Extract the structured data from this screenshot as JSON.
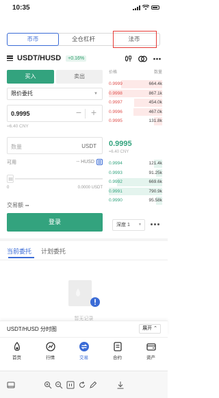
{
  "status": {
    "time": "10:35"
  },
  "tabs": [
    "币币",
    "全仓杠杆",
    "法币"
  ],
  "pair": {
    "name": "USDT/HUSD",
    "change": "+0.16%"
  },
  "trade": {
    "buy": "买入",
    "sell": "卖出",
    "order_type": "限价委托",
    "price": "0.9995",
    "price_cny": "≈6.40 CNY",
    "amount_placeholder": "数量",
    "amount_unit": "USDT",
    "available_label": "可用",
    "available_value": "-- HUSD",
    "slider_min": "0",
    "slider_max": "0.0000 USDT",
    "total_label": "交易额",
    "total_value": "--",
    "login": "登录"
  },
  "orderbook": {
    "price_header": "价格",
    "qty_header": "数量",
    "asks": [
      {
        "price": "0.9999",
        "qty": "664.4k"
      },
      {
        "price": "0.9998",
        "qty": "867.1k"
      },
      {
        "price": "0.9997",
        "qty": "454.0k"
      },
      {
        "price": "0.9996",
        "qty": "467.0k"
      },
      {
        "price": "0.9995",
        "qty": "131.8k"
      }
    ],
    "last_price": "0.9995",
    "last_cny": "≈6.40 CNY",
    "bids": [
      {
        "price": "0.9994",
        "qty": "121.4k"
      },
      {
        "price": "0.9993",
        "qty": "91.25k"
      },
      {
        "price": "0.9992",
        "qty": "669.6k"
      },
      {
        "price": "0.9991",
        "qty": "790.9k"
      },
      {
        "price": "0.9990",
        "qty": "95.58k"
      }
    ],
    "depth": "深度 1"
  },
  "orders": {
    "tab_current": "当前委托",
    "tab_plan": "计划委托",
    "empty": "暂无记录"
  },
  "chartbar": {
    "title": "USDT/HUSD 分时图",
    "expand": "展开"
  },
  "nav": [
    "首页",
    "行情",
    "交易",
    "合约",
    "资产"
  ],
  "colors": {
    "accent": "#3a6bd6",
    "green": "#33a37e",
    "red": "#e0504d"
  }
}
